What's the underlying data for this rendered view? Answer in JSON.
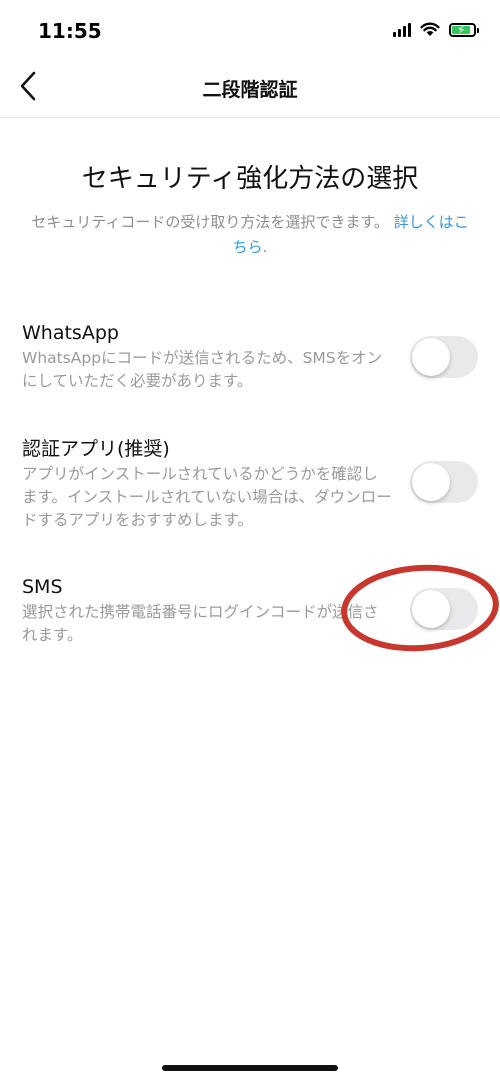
{
  "status_bar": {
    "time": "11:55",
    "icons": [
      "signal-icon",
      "wifi-icon",
      "battery-charging-icon"
    ]
  },
  "nav": {
    "title": "二段階認証",
    "back_icon": "chevron-left-icon"
  },
  "header": {
    "headline": "セキュリティ強化方法の選択",
    "subtitle": "セキュリティコードの受け取り方法を選択できます。",
    "link": "詳しくはこちら",
    "link_suffix": "."
  },
  "options": [
    {
      "title": "WhatsApp",
      "description": "WhatsAppにコードが送信されるため、SMSをオンにしていただく必要があります。",
      "enabled": false
    },
    {
      "title": "認証アプリ(推奨)",
      "description": "アプリがインストールされているかどうかを確認します。インストールされていない場合は、ダウンロードするアプリをおすすめします。",
      "enabled": false
    },
    {
      "title": "SMS",
      "description": "選択された携帯電話番号にログインコードが送信されます。",
      "enabled": false
    }
  ],
  "colors": {
    "link": "#3797d6",
    "annotation": "#c8372d",
    "toggle_off": "#e9e9eb",
    "battery": "#35c759"
  }
}
